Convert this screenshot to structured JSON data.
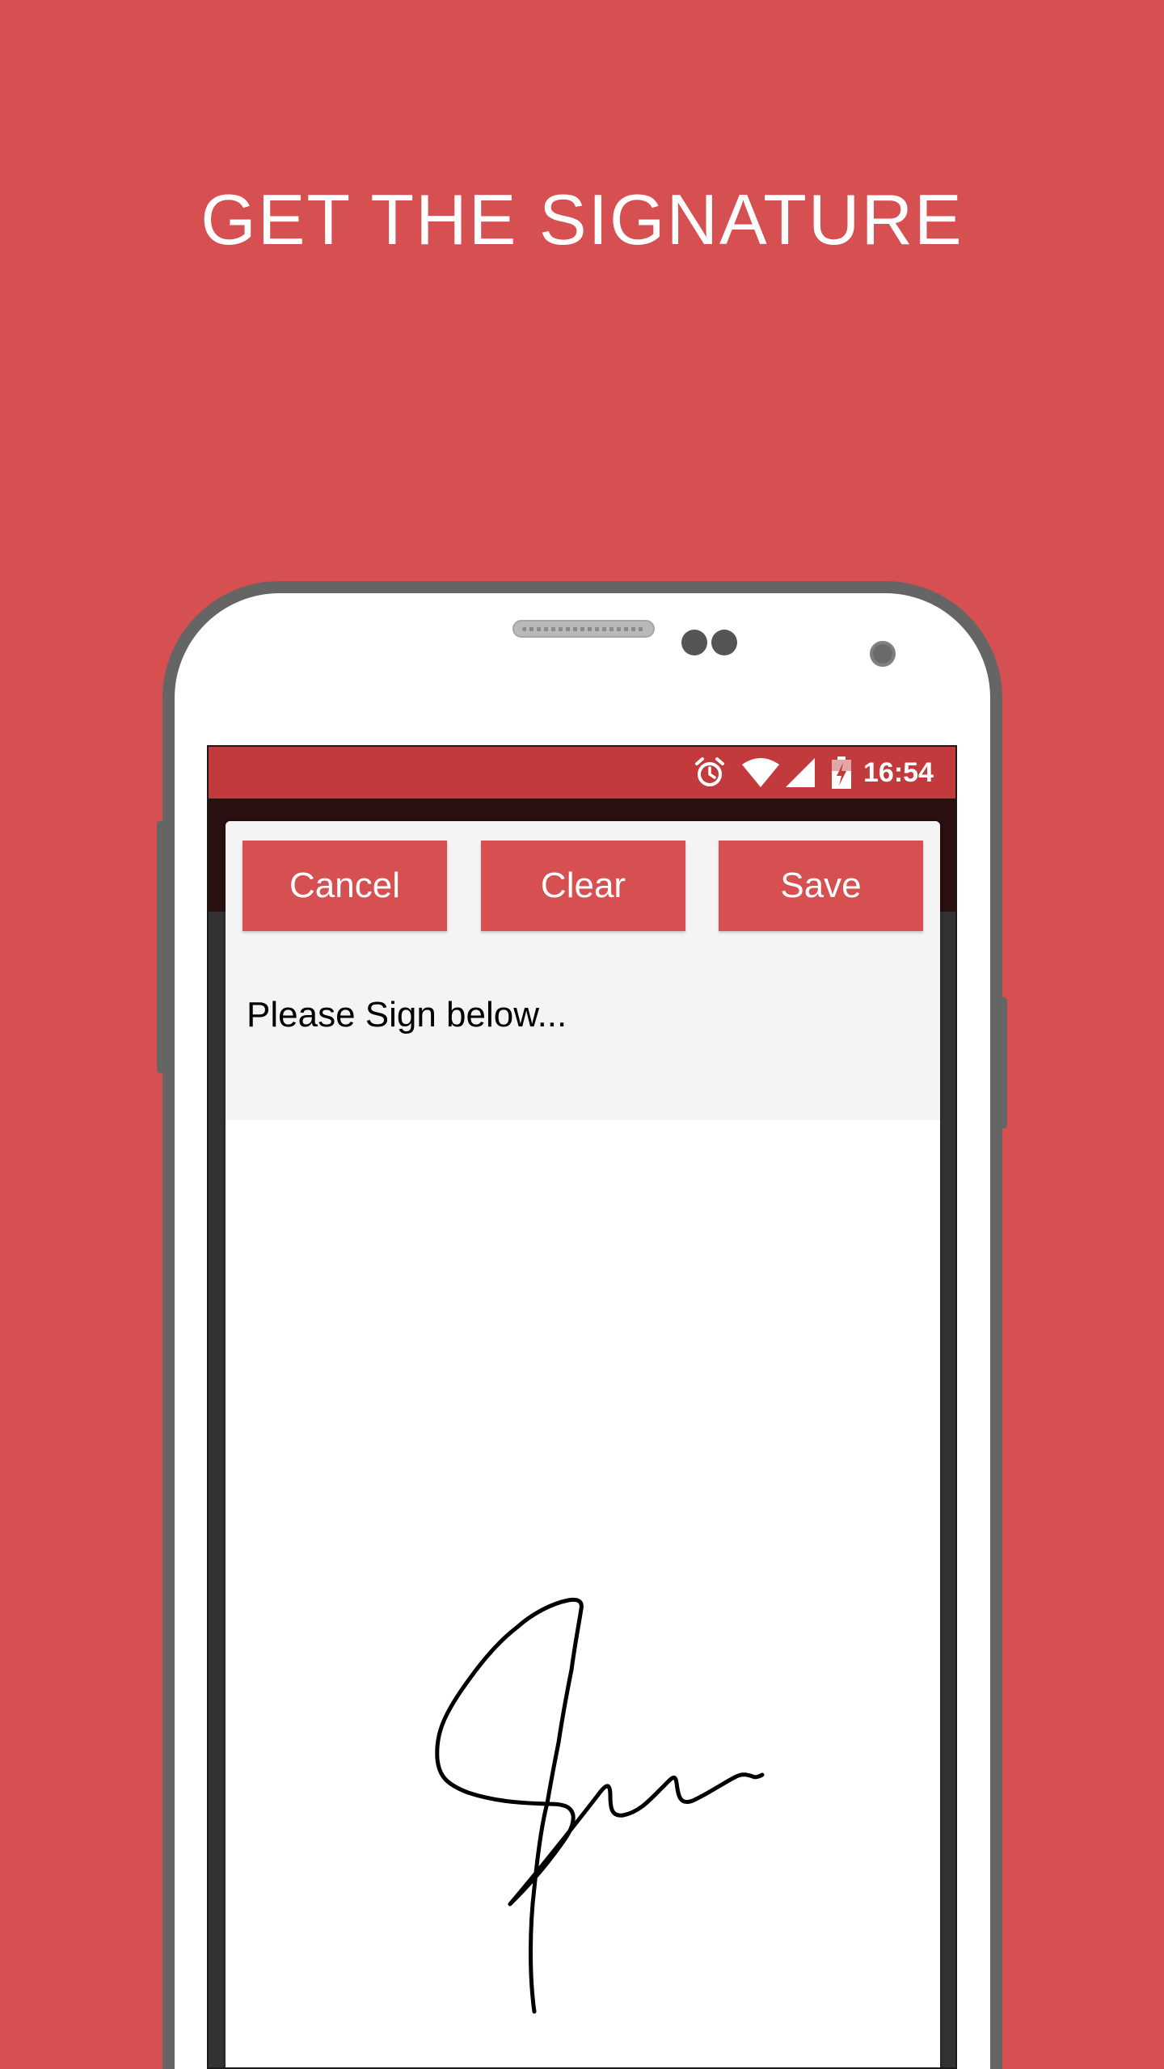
{
  "headline": "GET THE SIGNATURE",
  "colors": {
    "background": "#d75051",
    "status_bar": "#c23a3c",
    "button": "#d75051",
    "phone_frame": "#656565"
  },
  "status_bar": {
    "time": "16:54",
    "icons": [
      "alarm-icon",
      "wifi-icon",
      "signal-icon",
      "battery-charging-icon"
    ]
  },
  "dialog": {
    "buttons": {
      "cancel": "Cancel",
      "clear": "Clear",
      "save": "Save"
    },
    "prompt": "Please Sign below..."
  }
}
